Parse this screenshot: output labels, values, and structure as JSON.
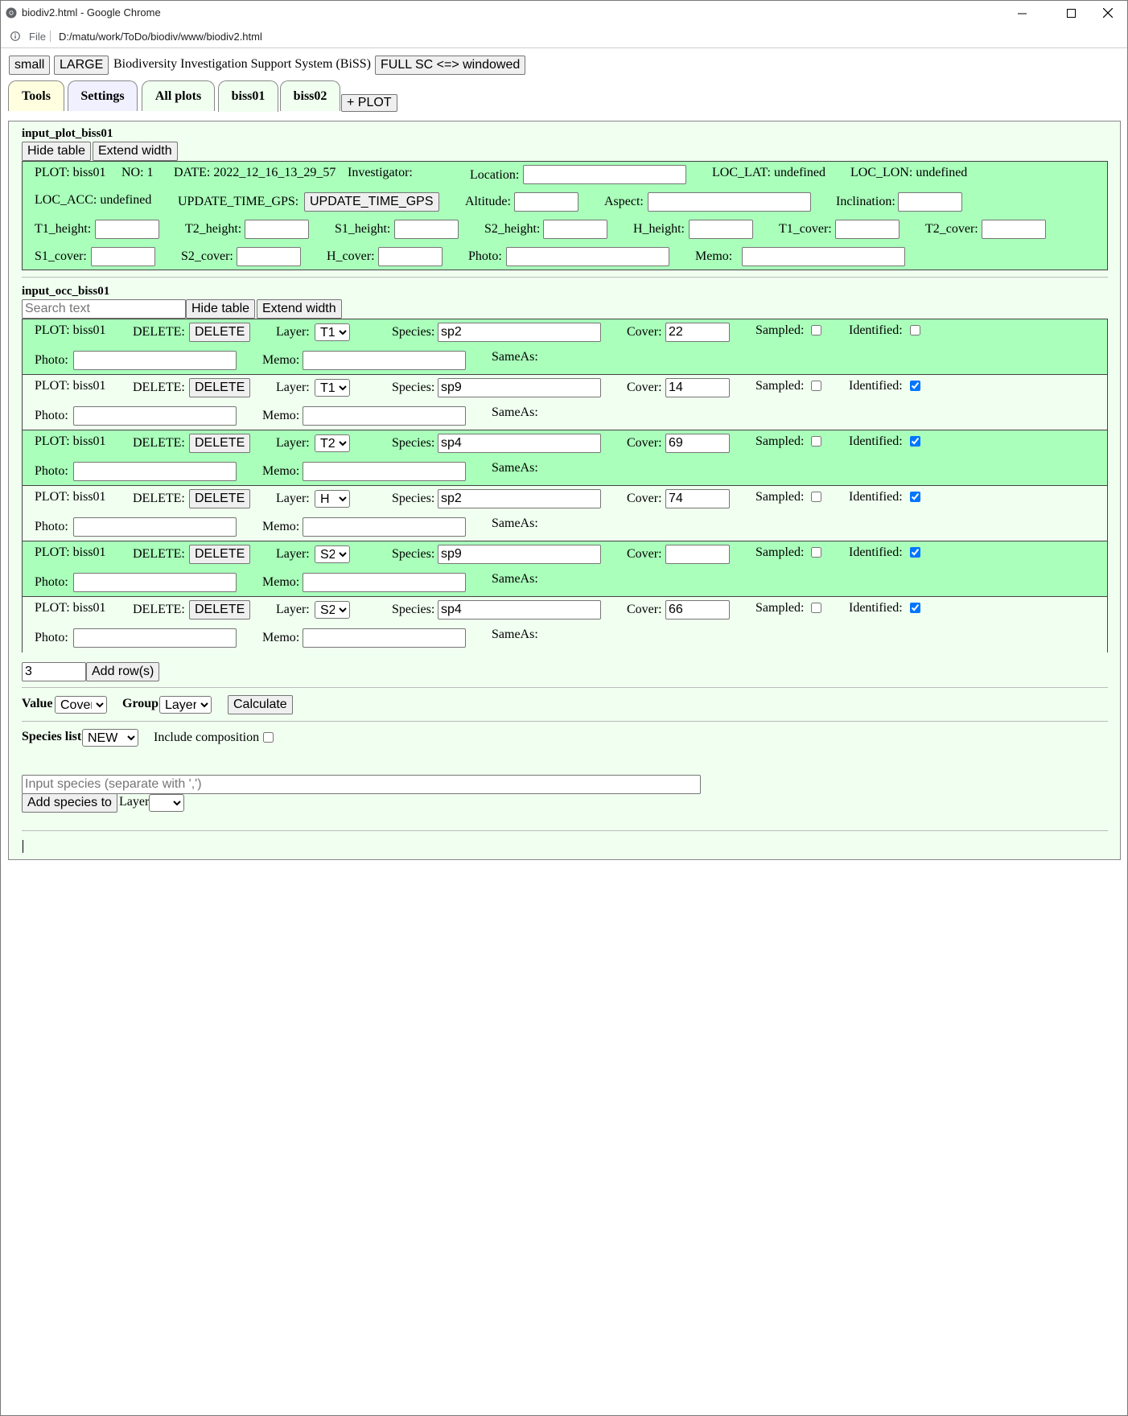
{
  "window": {
    "title": "biodiv2.html - Google Chrome",
    "scheme": "File",
    "url": "D:/matu/work/ToDo/biodiv/www/biodiv2.html"
  },
  "topbar": {
    "small_label": "small",
    "large_label": "LARGE",
    "app_title": "Biodiversity Investigation Support System (BiSS)",
    "fullscreen_label": "FULL SC <=> windowed"
  },
  "tabs": [
    {
      "label": "Tools"
    },
    {
      "label": "Settings"
    },
    {
      "label": "All plots"
    },
    {
      "label": "biss01"
    },
    {
      "label": "biss02"
    }
  ],
  "add_plot_label": "+ PLOT",
  "plot_section": {
    "heading": "input_plot_biss01",
    "hide_label": "Hide table",
    "extend_label": "Extend width",
    "plot": "PLOT: biss01",
    "no": "NO: 1",
    "date": "DATE: 2022_12_16_13_29_57",
    "investigator": "Investigator:",
    "location": "Location:",
    "loc_lat": "LOC_LAT: undefined",
    "loc_lon": "LOC_LON: undefined",
    "loc_acc": "LOC_ACC: undefined",
    "update_time_gps": "UPDATE_TIME_GPS:",
    "update_time_gps_button": "UPDATE_TIME_GPS",
    "altitude": "Altitude:",
    "aspect": "Aspect:",
    "inclination": "Inclination:",
    "t1_height": "T1_height:",
    "t2_height": "T2_height:",
    "s1_height": "S1_height:",
    "s2_height": "S2_height:",
    "h_height": "H_height:",
    "t1_cover": "T1_cover:",
    "t2_cover": "T2_cover:",
    "s1_cover": "S1_cover:",
    "s2_cover": "S2_cover:",
    "h_cover": "H_cover:",
    "photo": "Photo:",
    "memo": "Memo:"
  },
  "occ_section": {
    "heading": "input_occ_biss01",
    "search_placeholder": "Search text",
    "hide_label": "Hide table",
    "extend_label": "Extend width",
    "labels": {
      "plot": "PLOT: biss01",
      "delete": "DELETE:",
      "delete_button": "DELETE",
      "layer": "Layer:",
      "species": "Species:",
      "cover": "Cover:",
      "sampled": "Sampled:",
      "identified": "Identified:",
      "photo": "Photo:",
      "memo": "Memo:",
      "sameas": "SameAs:"
    },
    "rows": [
      {
        "layer": "T1",
        "species": "sp2",
        "cover": "22",
        "sampled": false,
        "identified": false
      },
      {
        "layer": "T1",
        "species": "sp9",
        "cover": "14",
        "sampled": false,
        "identified": true
      },
      {
        "layer": "T2",
        "species": "sp4",
        "cover": "69",
        "sampled": false,
        "identified": true
      },
      {
        "layer": "H",
        "species": "sp2",
        "cover": "74",
        "sampled": false,
        "identified": true
      },
      {
        "layer": "S2",
        "species": "sp9",
        "cover": "",
        "sampled": false,
        "identified": true
      },
      {
        "layer": "S2",
        "species": "sp4",
        "cover": "66",
        "sampled": false,
        "identified": true
      }
    ],
    "add_rows_value": "3",
    "add_rows_label": "Add row(s)"
  },
  "calc": {
    "value_label": "Value",
    "value_selected": "Cover",
    "group_label": "Group",
    "group_selected": "Layer",
    "calculate_label": "Calculate"
  },
  "species_list": {
    "label": "Species list",
    "selected": "NEW",
    "include_label": "Include composition",
    "input_placeholder": "Input species (separate with ',')",
    "add_button_label": "Add species to",
    "layer_label": "Layer",
    "layer_selected": ""
  },
  "colors": {
    "green_box": "#aaffbb",
    "panel_bg": "#f0fff0",
    "tab_tools": "#ffffe0",
    "tab_settings": "#f0f0ff",
    "checkbox_accent": "#0075ff"
  }
}
